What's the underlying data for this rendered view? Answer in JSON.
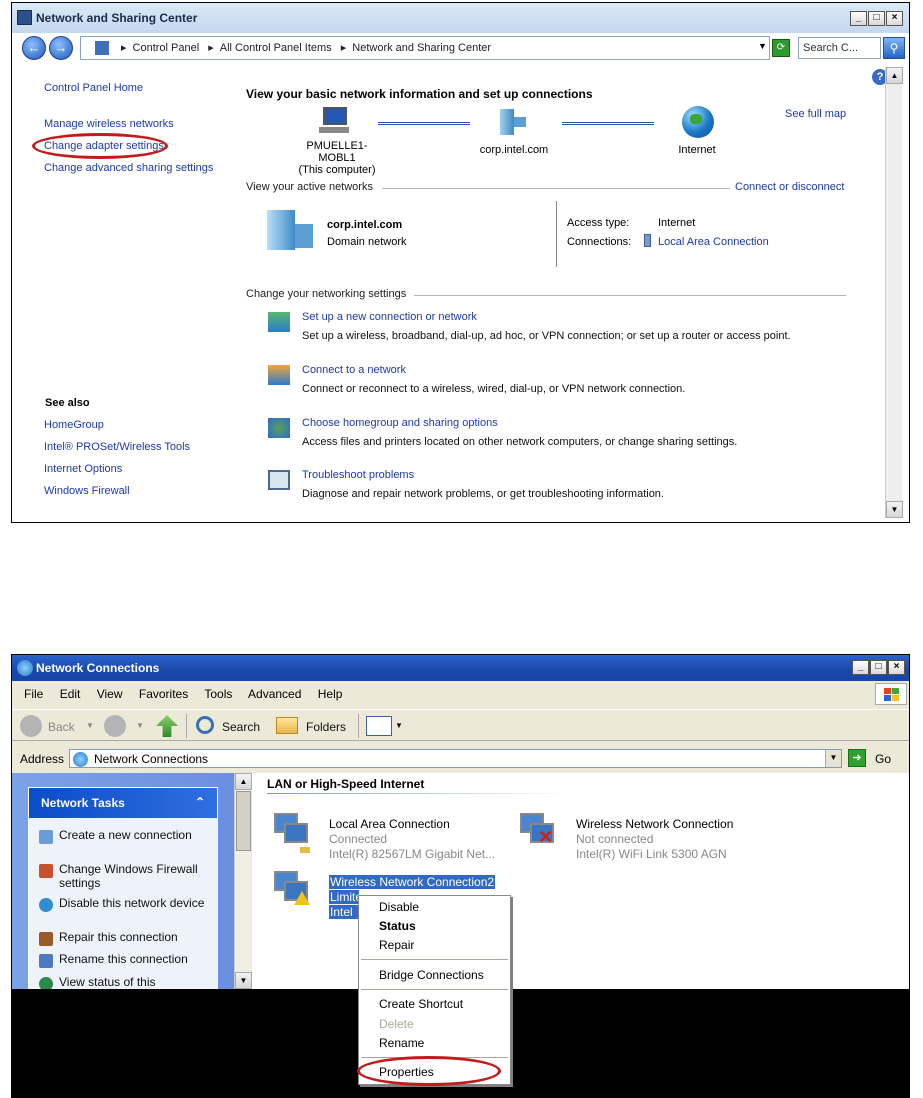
{
  "window1": {
    "title": "Network and Sharing Center",
    "breadcrumb": [
      "Control Panel",
      "All Control Panel Items",
      "Network and Sharing Center"
    ],
    "search_placeholder": "Search C...",
    "left_links": [
      "Control Panel Home",
      "Manage wireless networks",
      "Change adapter settings",
      "Change advanced sharing settings"
    ],
    "see_also_title": "See also",
    "see_also": [
      "HomeGroup",
      "Intel® PROSet/Wireless Tools",
      "Internet Options",
      "Windows Firewall"
    ],
    "heading": "View your basic network information and set up connections",
    "see_full_map": "See full map",
    "map_nodes": [
      {
        "name": "PMUELLE1-MOBL1",
        "sub": "(This computer)"
      },
      {
        "name": "corp.intel.com",
        "sub": ""
      },
      {
        "name": "Internet",
        "sub": ""
      }
    ],
    "active_networks_label": "View your active networks",
    "connect_disconnect": "Connect or disconnect",
    "network_name": "corp.intel.com",
    "network_type": "Domain network",
    "access_type_label": "Access type:",
    "access_type_value": "Internet",
    "connections_label": "Connections:",
    "connections_value": "Local Area Connection",
    "change_settings_label": "Change your networking settings",
    "tasks": [
      {
        "title": "Set up a new connection or network",
        "desc": "Set up a wireless, broadband, dial-up, ad hoc, or VPN connection; or set up a router or access point."
      },
      {
        "title": "Connect to a network",
        "desc": "Connect or reconnect to a wireless, wired, dial-up, or VPN network connection."
      },
      {
        "title": "Choose homegroup and sharing options",
        "desc": "Access files and printers located on other network computers, or change sharing settings."
      },
      {
        "title": "Troubleshoot problems",
        "desc": "Diagnose and repair network problems, or get troubleshooting information."
      }
    ]
  },
  "window2": {
    "title": "Network Connections",
    "menu": [
      "File",
      "Edit",
      "View",
      "Favorites",
      "Tools",
      "Advanced",
      "Help"
    ],
    "toolbar": {
      "back": "Back",
      "search": "Search",
      "folders": "Folders"
    },
    "address_label": "Address",
    "address_value": "Network Connections",
    "go_label": "Go",
    "task_pane_title": "Network Tasks",
    "task_items": [
      "Create a new connection",
      "Change Windows Firewall settings",
      "Disable this network device",
      "Repair this connection",
      "Rename this connection",
      "View status of this"
    ],
    "group_header": "LAN or High-Speed Internet",
    "connections": [
      {
        "name": "Local Area Connection",
        "status": "Connected",
        "device": "Intel(R) 82567LM Gigabit Net..."
      },
      {
        "name": "Wireless Network Connection",
        "status": "Not connected",
        "device": "Intel(R) WiFi Link 5300 AGN"
      },
      {
        "name": "Wireless Network Connection2",
        "status": "Limite",
        "device": "Intel"
      }
    ],
    "context_menu": [
      "Disable",
      "Status",
      "Repair",
      "Bridge Connections",
      "Create Shortcut",
      "Delete",
      "Rename",
      "Properties"
    ]
  }
}
